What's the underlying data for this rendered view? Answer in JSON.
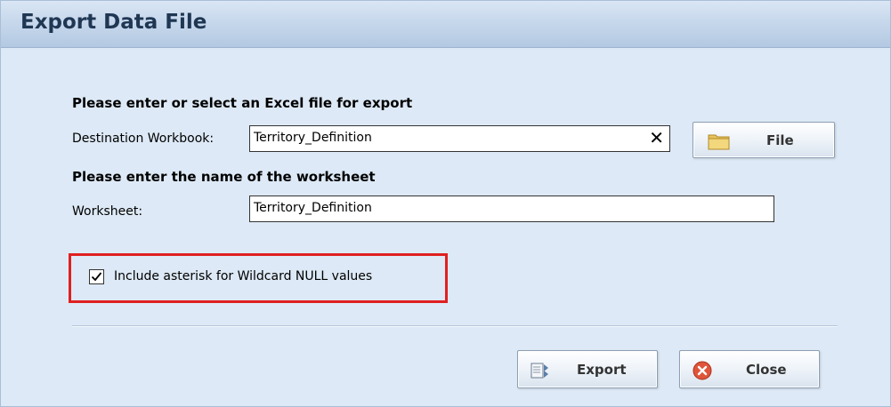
{
  "dialog": {
    "title": "Export Data File"
  },
  "export_section": {
    "heading": "Please enter or select an Excel file for export",
    "destination_label": "Destination Workbook:",
    "destination_value": "Territory_Definition",
    "clear_glyph": "✕",
    "file_button_label": "File",
    "file_button_icon": "folder-icon"
  },
  "worksheet_section": {
    "heading": "Please enter the name of the worksheet",
    "worksheet_label": "Worksheet:",
    "worksheet_value": "Territory_Definition"
  },
  "options": {
    "wildcard_checkbox_label": "Include asterisk for Wildcard NULL values",
    "wildcard_checked": true,
    "highlight_color": "#e02020"
  },
  "actions": {
    "export_label": "Export",
    "export_icon": "export-icon",
    "close_label": "Close",
    "close_icon": "close-circle-icon"
  },
  "colors": {
    "dialog_background": "#dde9f6",
    "title_text": "#1f3753"
  }
}
